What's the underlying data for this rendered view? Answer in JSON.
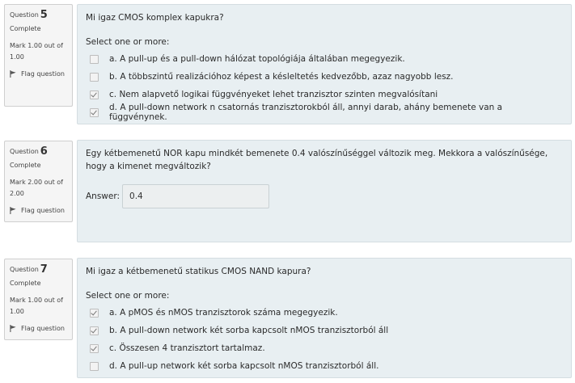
{
  "questions": [
    {
      "label": "Question",
      "number": "5",
      "state": "Complete",
      "grade": "Mark 1.00 out of 1.00",
      "flag": "Flag question",
      "text": "Mi igaz CMOS komplex kapukra?",
      "prompt": "Select one or more:",
      "answers": [
        {
          "text": "a. A pull-up és a pull-down hálózat topológiája általában megegyezik.",
          "checked": false
        },
        {
          "text": "b. A többszintű realizációhoz képest a késleltetés kedvezőbb, azaz nagyobb lesz.",
          "checked": false
        },
        {
          "text": "c. Nem alapvető logikai függvényeket lehet tranzisztor szinten megvalósítani",
          "checked": true
        },
        {
          "text": "d. A pull-down network n csatornás tranzisztorokból áll, annyi darab, ahány bemenete van a függvénynek.",
          "checked": true
        }
      ]
    },
    {
      "label": "Question",
      "number": "6",
      "state": "Complete",
      "grade": "Mark 2.00 out of 2.00",
      "flag": "Flag question",
      "text": "Egy kétbemenetű NOR kapu mindkét bemenete 0.4 valószínűséggel változik meg. Mekkora a valószínűsége, hogy a kimenet megváltozik?",
      "answer_label": "Answer:",
      "answer_value": "0.4"
    },
    {
      "label": "Question",
      "number": "7",
      "state": "Complete",
      "grade": "Mark 1.00 out of 1.00",
      "flag": "Flag question",
      "text": "Mi igaz a kétbemenetű statikus CMOS NAND kapura?",
      "prompt": "Select one or more:",
      "answers": [
        {
          "text": "a. A pMOS és nMOS tranzisztorok száma megegyezik.",
          "checked": true
        },
        {
          "text": "b. A pull-down network két sorba kapcsolt nMOS tranzisztorból áll",
          "checked": true
        },
        {
          "text": "c. Összesen 4 tranzisztort tartalmaz.",
          "checked": true
        },
        {
          "text": "d. A pull-up network két sorba kapcsolt nMOS tranzisztorból áll.",
          "checked": false
        }
      ]
    }
  ],
  "icons": {
    "flag": "flag-icon",
    "checkbox": "checkbox-icon"
  }
}
